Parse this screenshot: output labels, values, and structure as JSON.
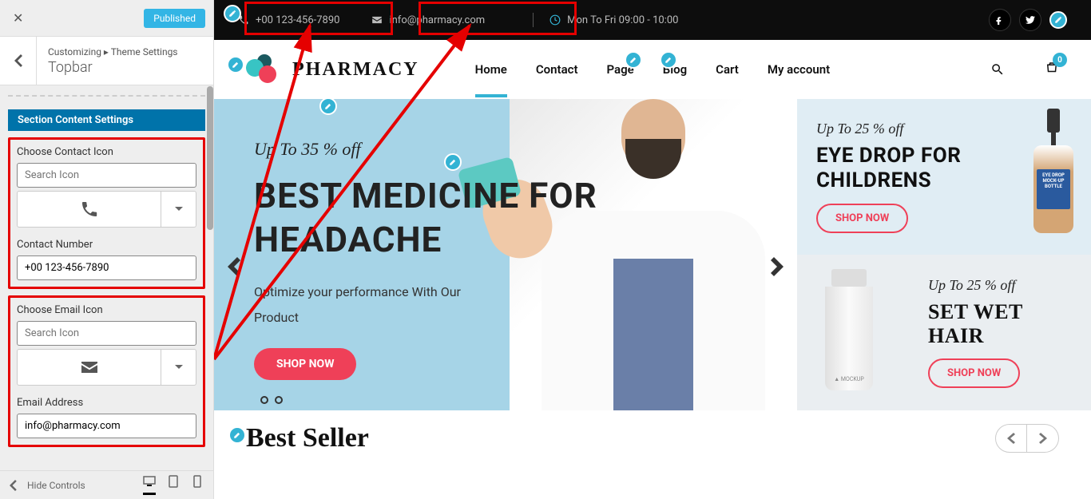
{
  "customizer": {
    "published_label": "Published",
    "breadcrumb_path": "Customizing ▸ Theme Settings",
    "breadcrumb_title": "Topbar",
    "section_label": "Section Content Settings",
    "contact_icon_label": "Choose Contact Icon",
    "contact_icon_placeholder": "Search Icon",
    "contact_number_label": "Contact Number",
    "contact_number_value": "+00 123-456-7890",
    "email_icon_label": "Choose Email Icon",
    "email_icon_placeholder": "Search Icon",
    "email_address_label": "Email Address",
    "email_address_value": "info@pharmacy.com",
    "hide_controls_label": "Hide Controls"
  },
  "topbar": {
    "phone": "+00 123-456-7890",
    "email": "info@pharmacy.com",
    "hours": "Mon To Fri 09:00 - 10:00"
  },
  "logo_text": "PHARMACY",
  "nav": {
    "home": "Home",
    "contact": "Contact",
    "page": "Page",
    "blog": "Blog",
    "cart": "Cart",
    "account": "My account",
    "cart_count": "0"
  },
  "hero": {
    "subtitle": "Up To 35 % off",
    "title_line1": "BEST MEDICINE FOR",
    "title_line2": "HEADACHE",
    "desc_line1": "Optimize your performance With Our",
    "desc_line2": "Product",
    "button": "SHOP NOW"
  },
  "side1": {
    "sub": "Up To 25 % off",
    "title_line1": "EYE DROP FOR",
    "title_line2": "CHILDRENS",
    "button": "SHOP NOW",
    "bottle_label": "EYE DROP MOCK-UP BOTTLE"
  },
  "side2": {
    "sub": "Up To 25 % off",
    "title": "SET WET HAIR",
    "button": "SHOP NOW",
    "tube_label": "▲ MOCKUP"
  },
  "best_seller_title": "Best Seller"
}
